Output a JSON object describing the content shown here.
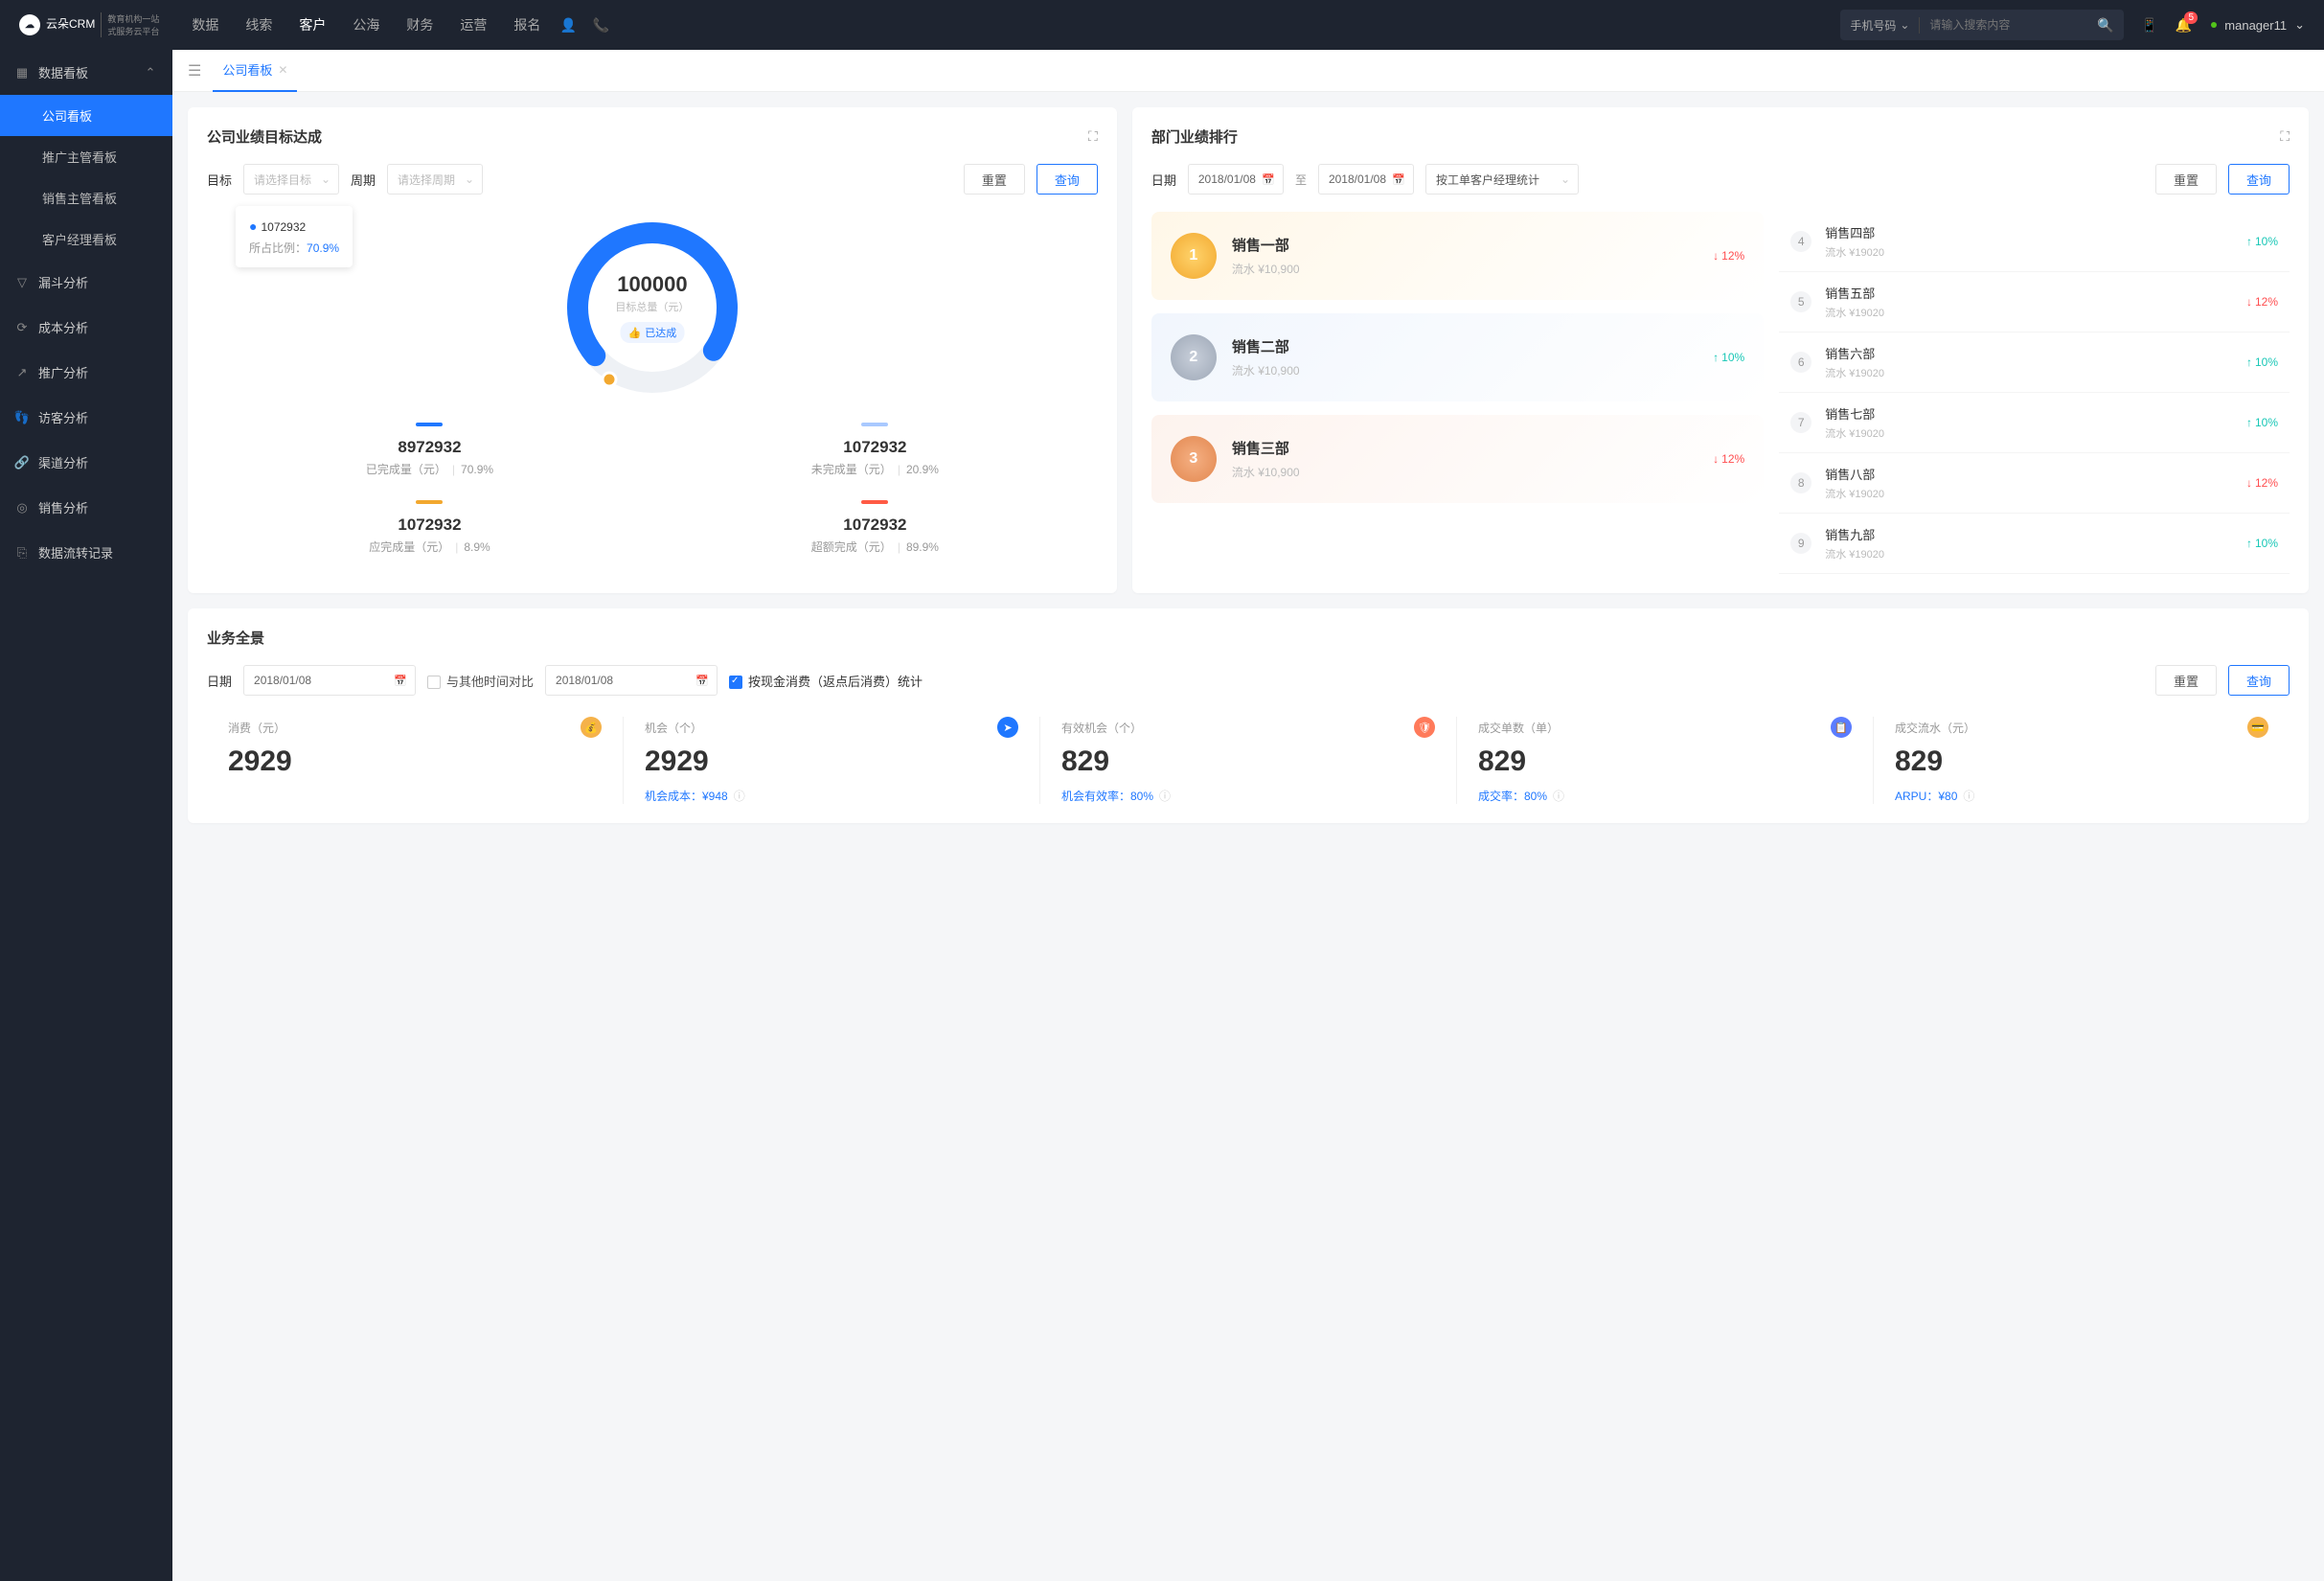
{
  "logo": {
    "main": "云朵CRM",
    "sub1": "教育机构一站",
    "sub2": "式服务云平台"
  },
  "topnav": [
    "数据",
    "线索",
    "客户",
    "公海",
    "财务",
    "运营",
    "报名"
  ],
  "topnav_active": 2,
  "search": {
    "type": "手机号码",
    "placeholder": "请输入搜索内容"
  },
  "notif_count": "5",
  "user": "manager11",
  "sidebar": {
    "group": "数据看板",
    "subs": [
      "公司看板",
      "推广主管看板",
      "销售主管看板",
      "客户经理看板"
    ],
    "active_sub": 0,
    "items": [
      "漏斗分析",
      "成本分析",
      "推广分析",
      "访客分析",
      "渠道分析",
      "销售分析",
      "数据流转记录"
    ]
  },
  "tab": "公司看板",
  "target": {
    "title": "公司业绩目标达成",
    "labels": {
      "target": "目标",
      "period": "周期",
      "target_ph": "请选择目标",
      "period_ph": "请选择周期",
      "reset": "重置",
      "query": "查询"
    },
    "tooltip": {
      "value": "1072932",
      "ratio_label": "所占比例：",
      "ratio": "70.9%"
    },
    "center": {
      "value": "100000",
      "label": "目标总量（元）",
      "badge": "已达成"
    },
    "stats": [
      {
        "color": "#1f77ff",
        "value": "8972932",
        "label": "已完成量（元）",
        "pct": "70.9%"
      },
      {
        "color": "#a9c9ff",
        "value": "1072932",
        "label": "未完成量（元）",
        "pct": "20.9%"
      },
      {
        "color": "#f2a82f",
        "value": "1072932",
        "label": "应完成量（元）",
        "pct": "8.9%"
      },
      {
        "color": "#ff5b45",
        "value": "1072932",
        "label": "超额完成（元）",
        "pct": "89.9%"
      }
    ]
  },
  "rank": {
    "title": "部门业绩排行",
    "labels": {
      "date": "日期",
      "to": "至",
      "stat": "按工单客户经理统计",
      "reset": "重置",
      "query": "查询"
    },
    "date1": "2018/01/08",
    "date2": "2018/01/08",
    "top": [
      {
        "pos": "1",
        "name": "销售一部",
        "sub": "流水 ¥10,900",
        "pct": "12%",
        "dir": "down"
      },
      {
        "pos": "2",
        "name": "销售二部",
        "sub": "流水 ¥10,900",
        "pct": "10%",
        "dir": "up"
      },
      {
        "pos": "3",
        "name": "销售三部",
        "sub": "流水 ¥10,900",
        "pct": "12%",
        "dir": "down"
      }
    ],
    "rest": [
      {
        "pos": "4",
        "name": "销售四部",
        "sub": "流水 ¥19020",
        "pct": "10%",
        "dir": "up"
      },
      {
        "pos": "5",
        "name": "销售五部",
        "sub": "流水 ¥19020",
        "pct": "12%",
        "dir": "down"
      },
      {
        "pos": "6",
        "name": "销售六部",
        "sub": "流水 ¥19020",
        "pct": "10%",
        "dir": "up"
      },
      {
        "pos": "7",
        "name": "销售七部",
        "sub": "流水 ¥19020",
        "pct": "10%",
        "dir": "up"
      },
      {
        "pos": "8",
        "name": "销售八部",
        "sub": "流水 ¥19020",
        "pct": "12%",
        "dir": "down"
      },
      {
        "pos": "9",
        "name": "销售九部",
        "sub": "流水 ¥19020",
        "pct": "10%",
        "dir": "up"
      }
    ]
  },
  "biz": {
    "title": "业务全景",
    "labels": {
      "date": "日期",
      "compare": "与其他时间对比",
      "stat": "按现金消费（返点后消费）统计",
      "reset": "重置",
      "query": "查询"
    },
    "date1": "2018/01/08",
    "date2": "2018/01/08",
    "cells": [
      {
        "label": "消费（元）",
        "value": "2929",
        "foot": "",
        "iconColor": "#f5b24a"
      },
      {
        "label": "机会（个）",
        "value": "2929",
        "foot": "机会成本：¥948",
        "iconColor": "#1f77ff"
      },
      {
        "label": "有效机会（个）",
        "value": "829",
        "foot": "机会有效率：80%",
        "iconColor": "#ff7a5a"
      },
      {
        "label": "成交单数（单）",
        "value": "829",
        "foot": "成交率：80%",
        "iconColor": "#5b7cff"
      },
      {
        "label": "成交流水（元）",
        "value": "829",
        "foot": "ARPU：¥80",
        "iconColor": "#f5b24a"
      }
    ]
  },
  "chart_data": {
    "type": "donut",
    "title": "目标总量（元） 100000",
    "series": [
      {
        "name": "已完成量（元）",
        "value": 8972932,
        "pct": 70.9,
        "color": "#1f77ff"
      },
      {
        "name": "未完成量（元）",
        "value": 1072932,
        "pct": 20.9,
        "color": "#a9c9ff"
      },
      {
        "name": "应完成量（元）",
        "value": 1072932,
        "pct": 8.9,
        "color": "#f2a82f"
      },
      {
        "name": "超额完成（元）",
        "value": 1072932,
        "pct": 89.9,
        "color": "#ff5b45"
      }
    ]
  }
}
